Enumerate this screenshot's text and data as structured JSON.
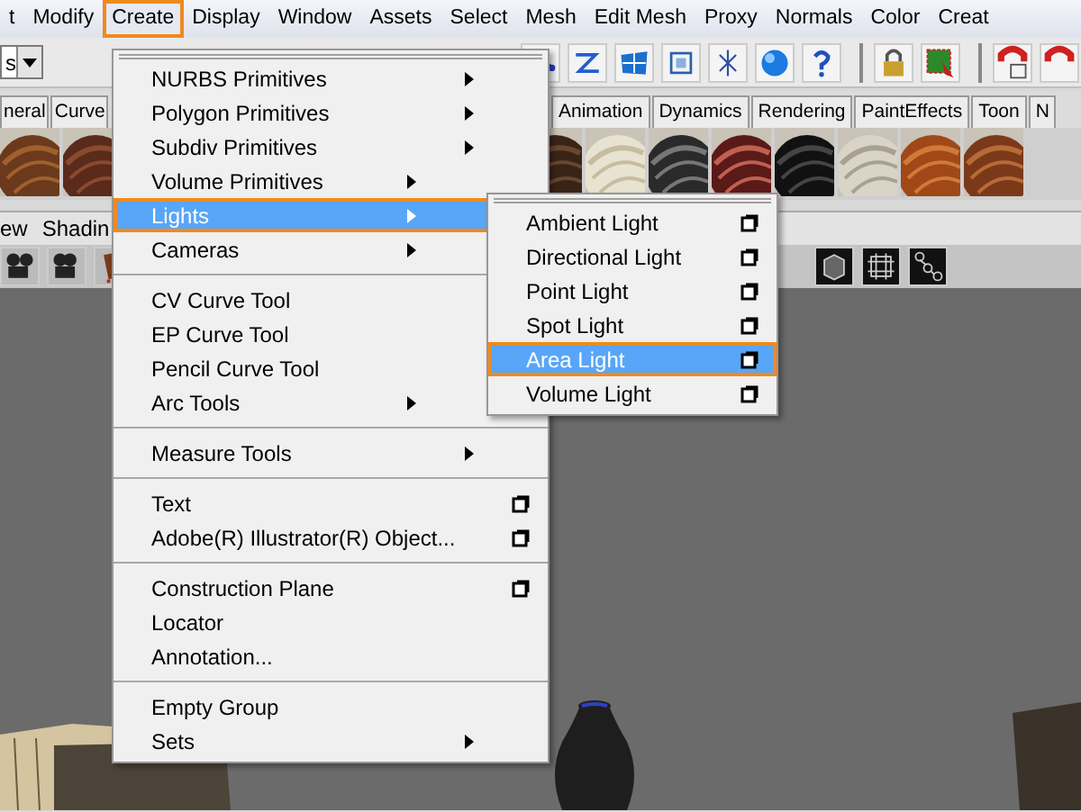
{
  "menu_bar": [
    {
      "label": "t",
      "selected": false
    },
    {
      "label": "Modify",
      "selected": false
    },
    {
      "label": "Create",
      "selected": true
    },
    {
      "label": "Display",
      "selected": false
    },
    {
      "label": "Window",
      "selected": false
    },
    {
      "label": "Assets",
      "selected": false
    },
    {
      "label": "Select",
      "selected": false
    },
    {
      "label": "Mesh",
      "selected": false
    },
    {
      "label": "Edit Mesh",
      "selected": false
    },
    {
      "label": "Proxy",
      "selected": false
    },
    {
      "label": "Normals",
      "selected": false
    },
    {
      "label": "Color",
      "selected": false
    },
    {
      "label": "Creat",
      "selected": false
    }
  ],
  "toolbar": {
    "mode_dropdown": "s"
  },
  "shelf_tabs_left": [
    {
      "label": "neral",
      "selected": false
    },
    {
      "label": "Curve",
      "selected": false
    }
  ],
  "shelf_tabs_right": [
    {
      "label": "Animation",
      "selected": false
    },
    {
      "label": "Dynamics",
      "selected": false
    },
    {
      "label": "Rendering",
      "selected": false
    },
    {
      "label": "PaintEffects",
      "selected": false
    },
    {
      "label": "Toon",
      "selected": false
    },
    {
      "label": "N",
      "selected": false
    }
  ],
  "panel_menu": [
    "ew",
    "Shadin"
  ],
  "create_menu": [
    {
      "kind": "item",
      "label": "NURBS Primitives",
      "submenu": true,
      "option_box": false,
      "selected": false
    },
    {
      "kind": "item",
      "label": "Polygon Primitives",
      "submenu": true,
      "option_box": false,
      "selected": false
    },
    {
      "kind": "item",
      "label": "Subdiv Primitives",
      "submenu": true,
      "option_box": false,
      "selected": false
    },
    {
      "kind": "item",
      "label": "Volume Primitives",
      "submenu": true,
      "selected": false
    },
    {
      "kind": "item",
      "label": "Lights",
      "submenu": true,
      "selected": true
    },
    {
      "kind": "item",
      "label": "Cameras",
      "submenu": true,
      "selected": false
    },
    {
      "kind": "separator"
    },
    {
      "kind": "item",
      "label": "CV Curve Tool",
      "submenu": false,
      "selected": false
    },
    {
      "kind": "item",
      "label": "EP Curve Tool",
      "submenu": false,
      "selected": false
    },
    {
      "kind": "item",
      "label": "Pencil Curve Tool",
      "submenu": false,
      "selected": false
    },
    {
      "kind": "item",
      "label": "Arc Tools",
      "submenu": true,
      "selected": false
    },
    {
      "kind": "separator"
    },
    {
      "kind": "item",
      "label": "Measure Tools",
      "submenu": true,
      "option_box": false,
      "selected": false
    },
    {
      "kind": "separator"
    },
    {
      "kind": "item",
      "label": "Text",
      "submenu": false,
      "option_box": true,
      "selected": false
    },
    {
      "kind": "item",
      "label": "Adobe(R) Illustrator(R) Object...",
      "submenu": false,
      "option_box": true,
      "selected": false
    },
    {
      "kind": "separator"
    },
    {
      "kind": "item",
      "label": "Construction Plane",
      "submenu": false,
      "option_box": true,
      "selected": false
    },
    {
      "kind": "item",
      "label": "Locator",
      "submenu": false,
      "option_box": false,
      "selected": false
    },
    {
      "kind": "item",
      "label": "Annotation...",
      "submenu": false,
      "option_box": false,
      "selected": false
    },
    {
      "kind": "separator"
    },
    {
      "kind": "item",
      "label": "Empty Group",
      "submenu": false,
      "option_box": false,
      "selected": false
    },
    {
      "kind": "item",
      "label": "Sets",
      "submenu": true,
      "option_box": false,
      "selected": false
    }
  ],
  "lights_submenu": [
    {
      "label": "Ambient Light",
      "option_box": true,
      "selected": false
    },
    {
      "label": "Directional Light",
      "option_box": true,
      "selected": false
    },
    {
      "label": "Point Light",
      "option_box": true,
      "selected": false
    },
    {
      "label": "Spot Light",
      "option_box": true,
      "selected": false
    },
    {
      "label": "Area Light",
      "option_box": true,
      "selected": true
    },
    {
      "label": "Volume Light",
      "option_box": true,
      "selected": false
    }
  ]
}
